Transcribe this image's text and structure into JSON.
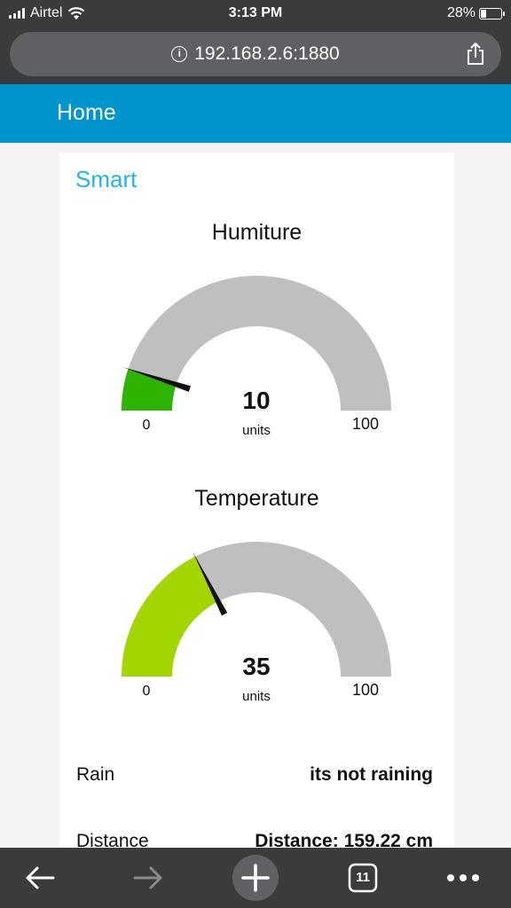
{
  "status_bar": {
    "carrier": "Airtel",
    "time": "3:13 PM",
    "battery": "28%",
    "battery_level": 0.28
  },
  "browser": {
    "url": "192.168.2.6:1880",
    "tab_count": "11"
  },
  "header": {
    "title": "Home"
  },
  "group": {
    "title": "Smart"
  },
  "gauges": [
    {
      "title": "Humiture",
      "value": "10",
      "units": "units",
      "min": "0",
      "max": "100",
      "fill_color": "#2db300",
      "level": 0.1
    },
    {
      "title": "Temperature",
      "value": "35",
      "units": "units",
      "min": "0",
      "max": "100",
      "fill_color": "#a3d600",
      "level": 0.35
    }
  ],
  "rows": [
    {
      "label": "Rain",
      "value": "its not raining"
    },
    {
      "label": "Distance",
      "value": "Distance: 159.22 cm"
    }
  ],
  "icons": [
    "wifi-icon",
    "info-icon",
    "share-icon",
    "back-icon",
    "forward-icon",
    "new-tab-icon",
    "tabs-icon",
    "more-icon"
  ]
}
